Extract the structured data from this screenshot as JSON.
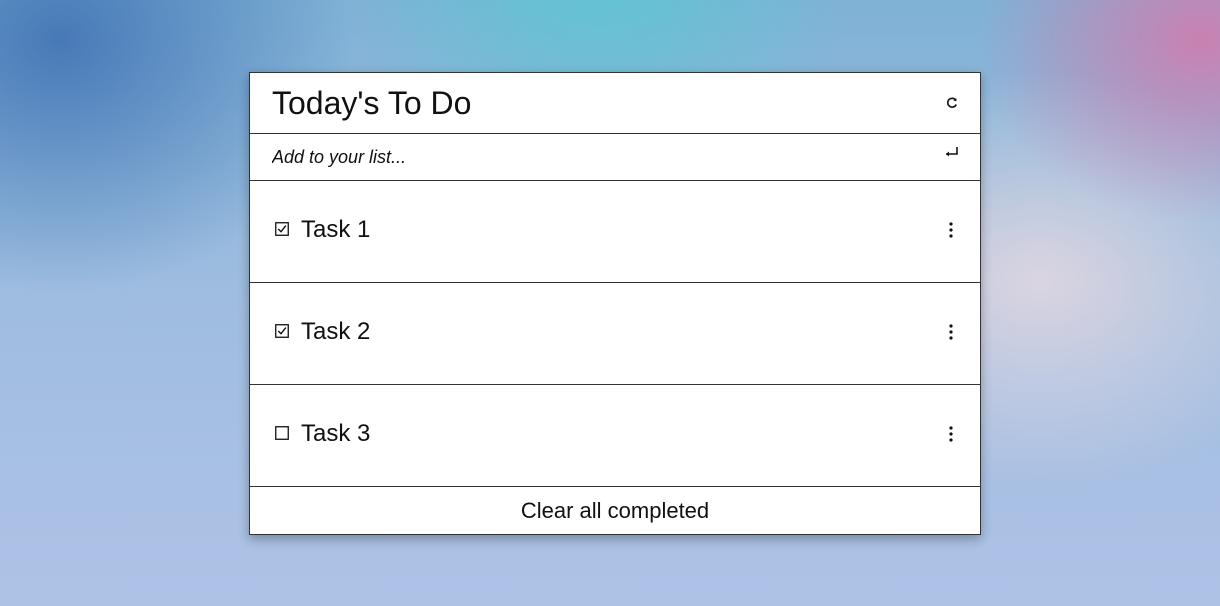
{
  "header": {
    "title": "Today's To Do",
    "refresh_icon": "refresh-icon"
  },
  "add": {
    "placeholder": "Add to your list...",
    "value": "",
    "enter_icon": "enter-return-icon"
  },
  "tasks": [
    {
      "label": "Task 1",
      "completed": true,
      "menu_icon": "more-vertical-icon"
    },
    {
      "label": "Task 2",
      "completed": true,
      "menu_icon": "more-vertical-icon"
    },
    {
      "label": "Task 3",
      "completed": false,
      "menu_icon": "more-vertical-icon"
    }
  ],
  "footer": {
    "clear_label": "Clear all completed"
  }
}
